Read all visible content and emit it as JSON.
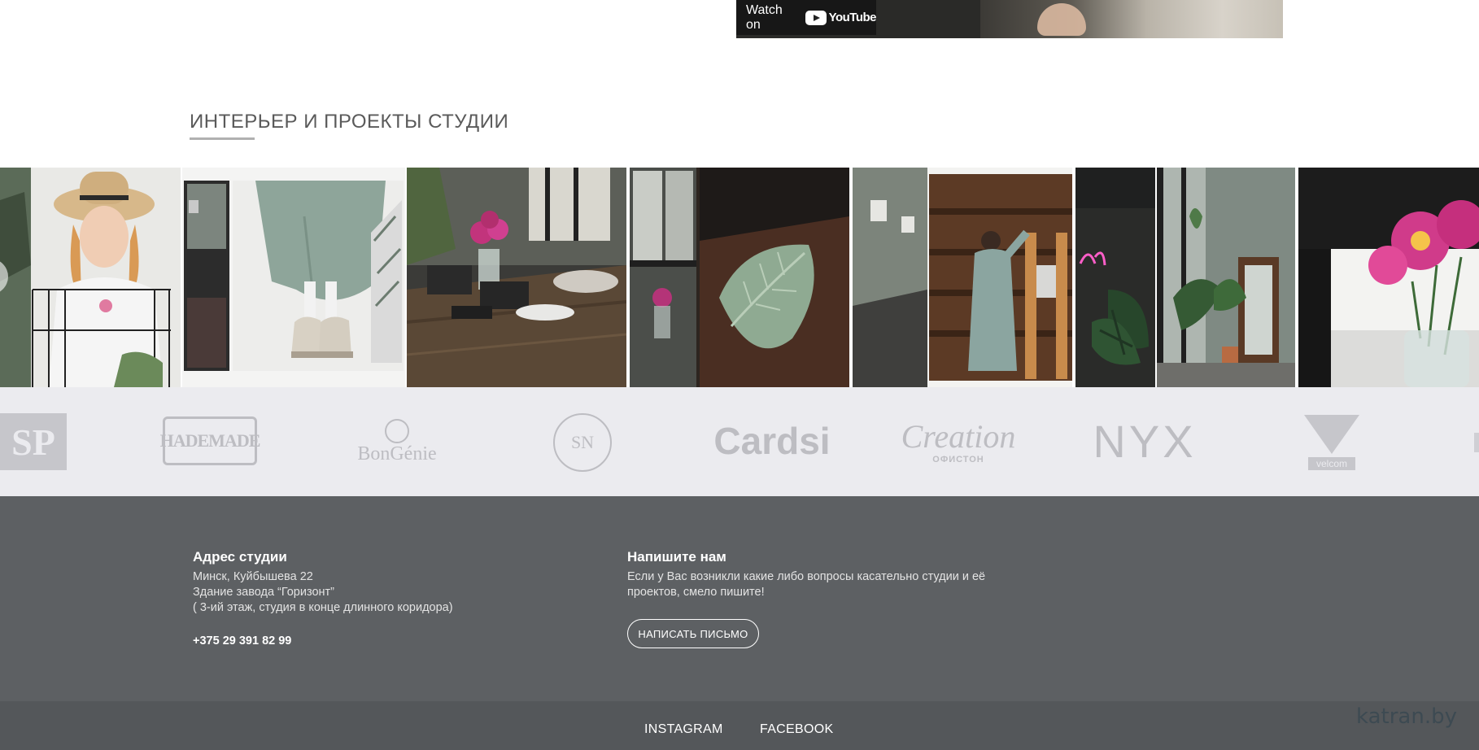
{
  "video": {
    "watch_label": "Watch on",
    "yt_brand": "YouTube"
  },
  "section": {
    "title": "ИНТЕРЬЕР И ПРОЕКТЫ СТУДИИ"
  },
  "gallery": {
    "photos": [
      "girl-in-hat",
      "green-skirt-boots",
      "studio-desk-flowers",
      "leaf-ceramic-plate",
      "woman-at-shelves",
      "neon-plant",
      "window-plants-mirror",
      "pink-asters-vase"
    ]
  },
  "logos": {
    "items": [
      "SP",
      "HADEMADE",
      "BonGénie",
      "SN",
      "Cardsi",
      "Creation",
      "ОФИСТОН",
      "NYX",
      "velcom"
    ]
  },
  "footer": {
    "address_title": "Адрес студии",
    "address_line1": "Минск, Куйбышева 22",
    "address_line2": "Здание завода “Горизонт”",
    "address_line3": "( 3-ий этаж, студия в конце длинного коридора)",
    "phone": "+375 29 391 82 99",
    "contact_title": "Напишите нам",
    "contact_line1": "Если у Вас возникли какие либо вопросы касательно студии и её",
    "contact_line2": "проектов, смело пишите!",
    "write_button": "НАПИСАТЬ ПИСЬМО"
  },
  "nav": {
    "instagram": "INSTAGRAM",
    "facebook": "FACEBOOK"
  },
  "watermark": "katran.by"
}
